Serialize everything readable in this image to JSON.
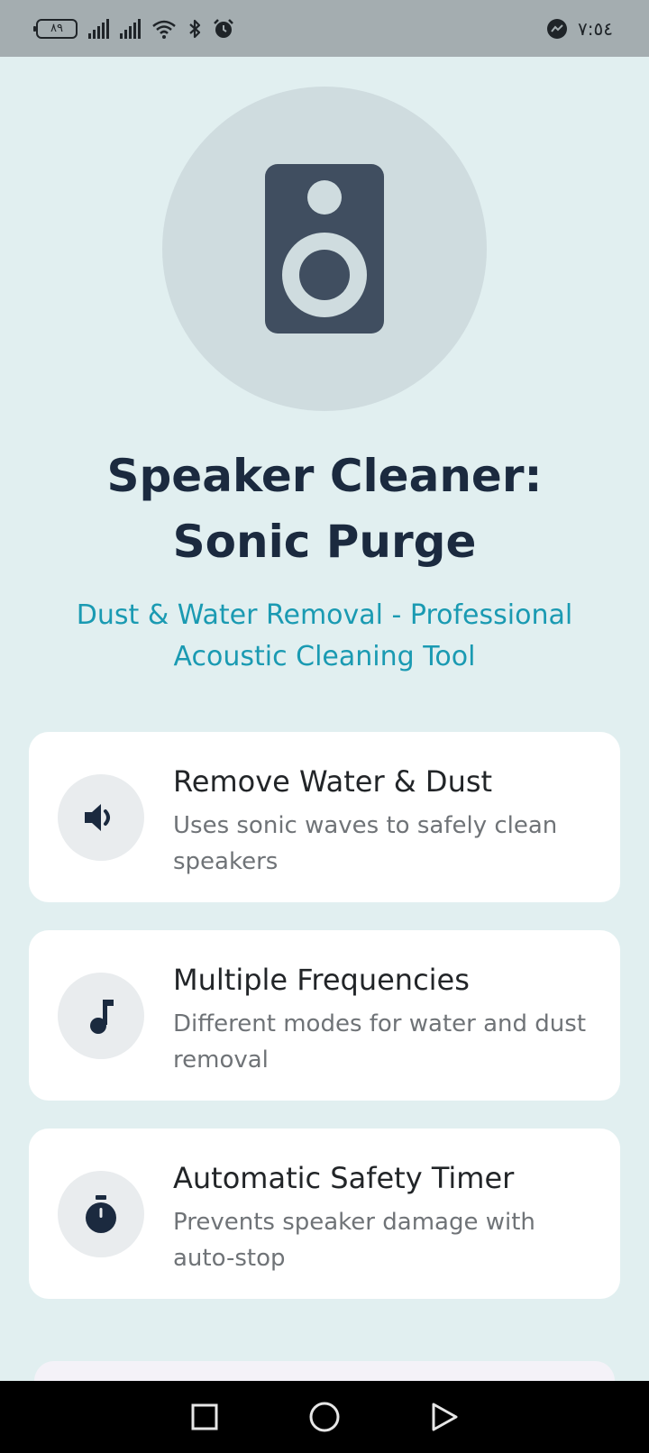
{
  "status_bar": {
    "battery": "٨٩",
    "time": "٧:٥٤"
  },
  "app": {
    "title": "Speaker Cleaner: Sonic Purge",
    "subtitle": "Dust & Water Removal - Professional Acoustic Cleaning Tool"
  },
  "features": [
    {
      "icon": "speaker-volume-icon",
      "title": "Remove Water & Dust",
      "description": "Uses sonic waves to safely clean speakers"
    },
    {
      "icon": "music-note-icon",
      "title": "Multiple Frequencies",
      "description": "Different modes for water and dust removal"
    },
    {
      "icon": "stopwatch-icon",
      "title": "Automatic Safety Timer",
      "description": "Prevents speaker damage with auto-stop"
    }
  ],
  "colors": {
    "background": "#e1eff0",
    "title": "#1b2a3f",
    "accent": "#1a9ab2",
    "card": "#ffffff"
  },
  "nav": [
    "recent-apps-icon",
    "home-icon",
    "back-icon"
  ]
}
